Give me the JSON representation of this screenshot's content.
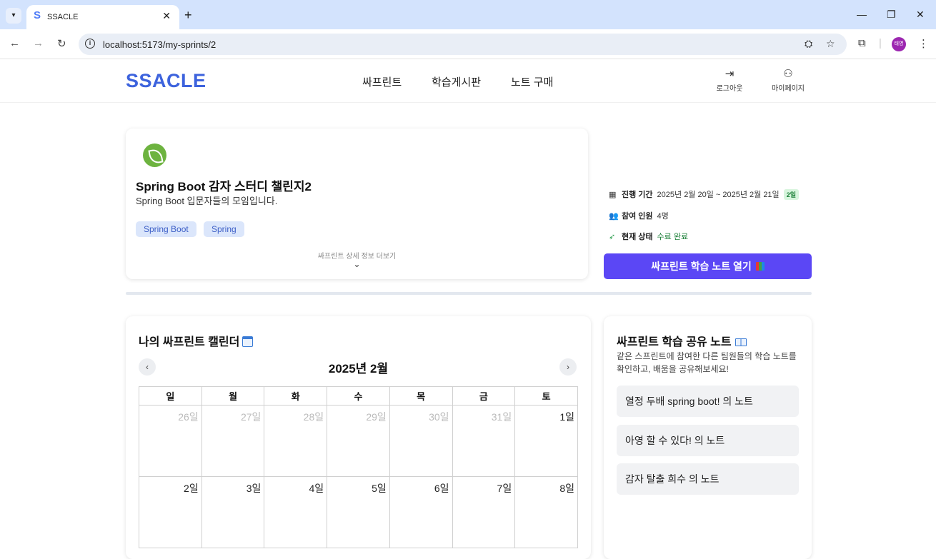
{
  "browser": {
    "tab_title": "SSACLE",
    "tab_favicon": "S",
    "url": "localhost:5173/my-sprints/2",
    "profile_initials": "태영"
  },
  "header": {
    "logo": "SSACLE",
    "nav": [
      "싸프린트",
      "학습게시판",
      "노트 구매"
    ],
    "logout_label": "로그아웃",
    "mypage_label": "마이페이지"
  },
  "sprint": {
    "title": "Spring Boot 감자 스터디 챌린지2",
    "description": "Spring Boot 입문자들의 모임입니다.",
    "tags": [
      "Spring Boot",
      "Spring"
    ],
    "more_label": "싸프린트 상세 정보 더보기"
  },
  "info": {
    "period_label": "진행 기간",
    "period_value": "2025년 2월 20일 ~ 2025년 2월 21일",
    "period_badge": "2일",
    "members_label": "참여 인원",
    "members_value": "4명",
    "status_label": "현재 상태",
    "status_value": "수료 완료",
    "open_note_button": "싸프린트 학습 노트 열기"
  },
  "calendar": {
    "title": "나의 싸프린트 캘린더",
    "month": "2025년 2월",
    "weekdays": [
      "일",
      "월",
      "화",
      "수",
      "목",
      "금",
      "토"
    ],
    "week1": [
      "26일",
      "27일",
      "28일",
      "29일",
      "30일",
      "31일",
      "1일"
    ],
    "week2": [
      "2일",
      "3일",
      "4일",
      "5일",
      "6일",
      "7일",
      "8일"
    ]
  },
  "shared_notes": {
    "title": "싸프린트 학습 공유 노트",
    "description": "같은 스프린트에 참여한 다른 팀원들의 학습 노트를 확인하고, 배움을 공유해보세요!",
    "items": [
      "열정 두배 spring boot! 의 노트",
      "아영 할 수 있다! 의 노트",
      "감자 탈출 희수 의 노트"
    ]
  },
  "colors": {
    "brand": "#3d63dd",
    "primary_button": "#5b47f5",
    "success": "#1a7f37"
  }
}
